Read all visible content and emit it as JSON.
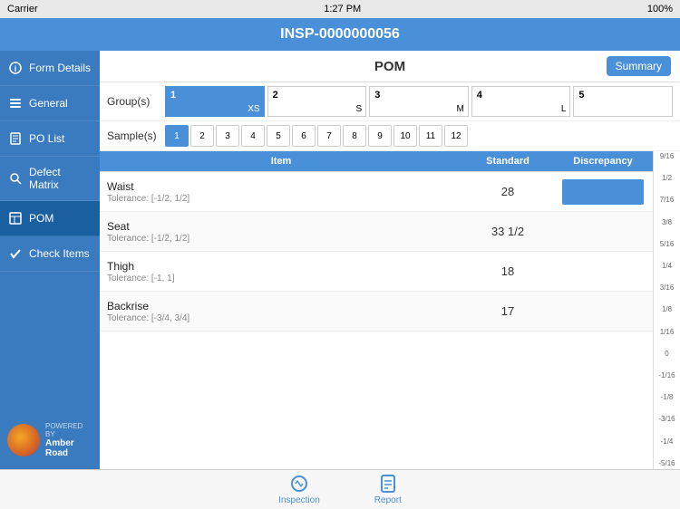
{
  "statusBar": {
    "carrier": "Carrier",
    "time": "1:27 PM",
    "battery": "100%",
    "signal": "WiFi"
  },
  "header": {
    "title": "INSP-0000000056"
  },
  "sidebar": {
    "items": [
      {
        "id": "form-details",
        "label": "Form Details",
        "icon": "info-icon",
        "active": false
      },
      {
        "id": "general",
        "label": "General",
        "icon": "list-icon",
        "active": false
      },
      {
        "id": "po-list",
        "label": "PO List",
        "icon": "document-icon",
        "active": false
      },
      {
        "id": "defect-matrix",
        "label": "Defect Matrix",
        "icon": "search-icon",
        "active": false
      },
      {
        "id": "pom",
        "label": "POM",
        "icon": "table-icon",
        "active": true
      },
      {
        "id": "check-items",
        "label": "Check Items",
        "icon": "check-icon",
        "active": false
      }
    ],
    "logo": {
      "text": "Amber Road",
      "subtext": "POWERED BY"
    }
  },
  "content": {
    "title": "POM",
    "summaryButton": "Summary",
    "groupsLabel": "Group(s)",
    "groups": [
      {
        "num": "1",
        "size": "XS",
        "active": true
      },
      {
        "num": "2",
        "size": "S",
        "active": false
      },
      {
        "num": "3",
        "size": "M",
        "active": false
      },
      {
        "num": "4",
        "size": "L",
        "active": false
      },
      {
        "num": "5",
        "size": "",
        "active": false
      }
    ],
    "samplesLabel": "Sample(s)",
    "samples": [
      "1",
      "2",
      "3",
      "4",
      "5",
      "6",
      "7",
      "8",
      "9",
      "10",
      "11",
      "12"
    ],
    "activeSample": "1",
    "tableHeaders": {
      "item": "Item",
      "standard": "Standard",
      "discrepancy": "Discrepancy"
    },
    "rows": [
      {
        "name": "Waist",
        "tolerance": "Tolerance: [-1/2, 1/2]",
        "standard": "28",
        "hasDiscrepancy": true
      },
      {
        "name": "Seat",
        "tolerance": "Tolerance: [-1/2, 1/2]",
        "standard": "33 1/2",
        "hasDiscrepancy": false
      },
      {
        "name": "Thigh",
        "tolerance": "Tolerance: [-1, 1]",
        "standard": "18",
        "hasDiscrepancy": false
      },
      {
        "name": "Backrise",
        "tolerance": "Tolerance: [-3/4, 3/4]",
        "standard": "17",
        "hasDiscrepancy": false
      }
    ],
    "rulerMarks": [
      "9/16",
      "1/2",
      "7/16",
      "3/8",
      "5/16",
      "1/4",
      "3/16",
      "1/8",
      "1/16",
      "0",
      "-1/16",
      "-1/8",
      "-3/16",
      "-1/4",
      "-5/16"
    ]
  },
  "tabBar": {
    "tabs": [
      {
        "id": "inspection",
        "label": "Inspection",
        "icon": "inspection-icon"
      },
      {
        "id": "report",
        "label": "Report",
        "icon": "report-icon"
      }
    ]
  }
}
